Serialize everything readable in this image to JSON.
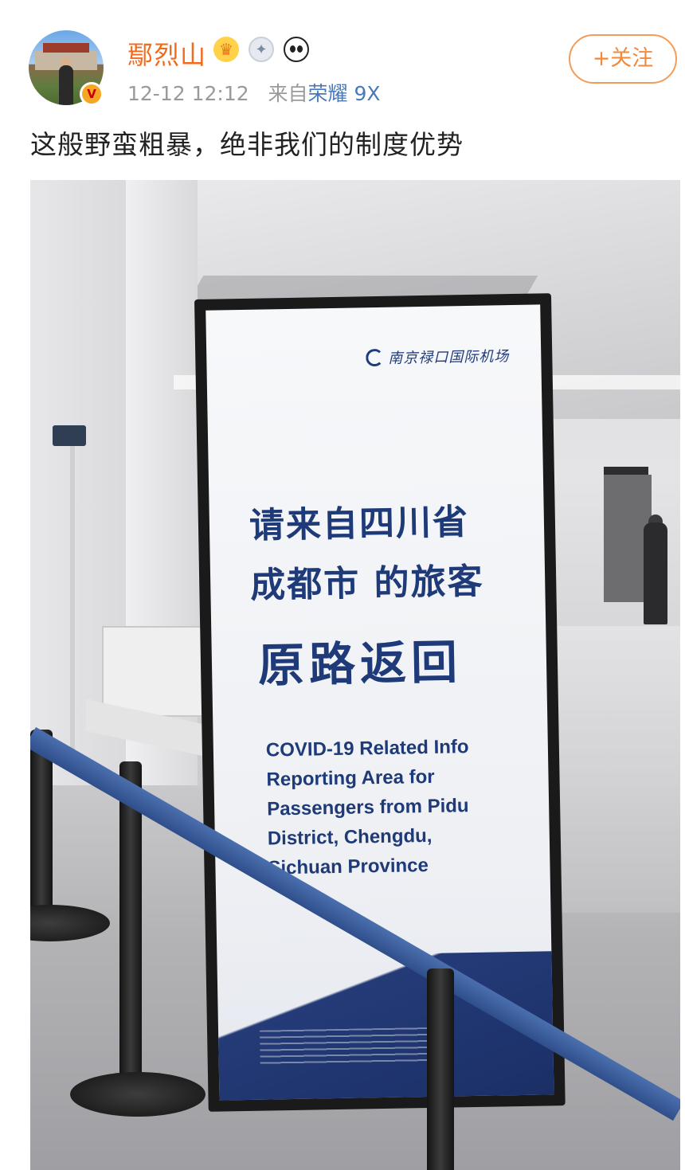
{
  "post": {
    "username": "鄢烈山",
    "timestamp": "12-12 12:12",
    "source_prefix": "来自",
    "source_device": "荣耀 9X",
    "follow_label": "+关注",
    "text": "这般野蛮粗暴，绝非我们的制度优势"
  },
  "icons": {
    "verified_badge": "v-badge-icon",
    "crown_badge": "crown-icon",
    "medal_badge": "medal-icon",
    "panda_badge": "panda-icon"
  },
  "photo": {
    "sign": {
      "logo_text": "南京禄口国际机场",
      "line1": "请来自四川省",
      "line2": "成都市 的旅客",
      "line3": "原路返回",
      "english": [
        "COVID-19 Related Info",
        "Reporting Area for",
        "Passengers from Pidu",
        "District, Chengdu,",
        "Sichuan Province"
      ]
    }
  },
  "colors": {
    "username": "#f26b1d",
    "follow": "#f28a3d",
    "source_link": "#4a79b8",
    "sign_text": "#1e3a78"
  }
}
